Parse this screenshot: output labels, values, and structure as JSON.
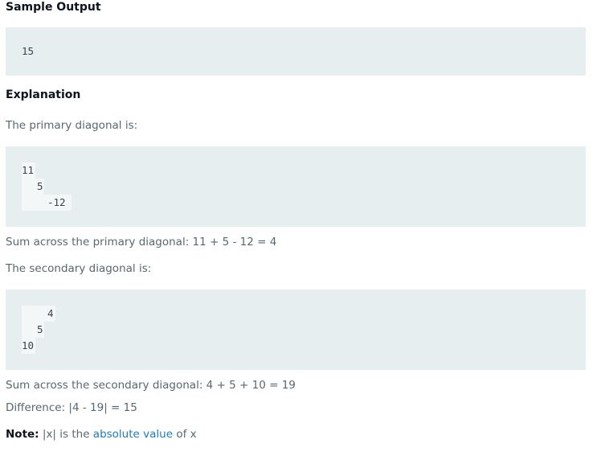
{
  "sample_output": {
    "heading": "Sample Output",
    "value": "15"
  },
  "explanation": {
    "heading": "Explanation",
    "primary_intro": "The primary diagonal is:",
    "primary_lines": [
      "11",
      "5",
      "-12"
    ],
    "primary_sum": "Sum across the primary diagonal: 11 + 5 - 12 = 4",
    "secondary_intro": "The secondary diagonal is:",
    "secondary_lines": [
      "4",
      "5",
      "10"
    ],
    "secondary_sum": "Sum across the secondary diagonal: 4 + 5 + 10 = 19",
    "difference": "Difference: |4 - 19| = 15",
    "note_label": "Note:",
    "note_pre": "|x| is the",
    "note_link": "absolute value",
    "note_post": "of x"
  }
}
